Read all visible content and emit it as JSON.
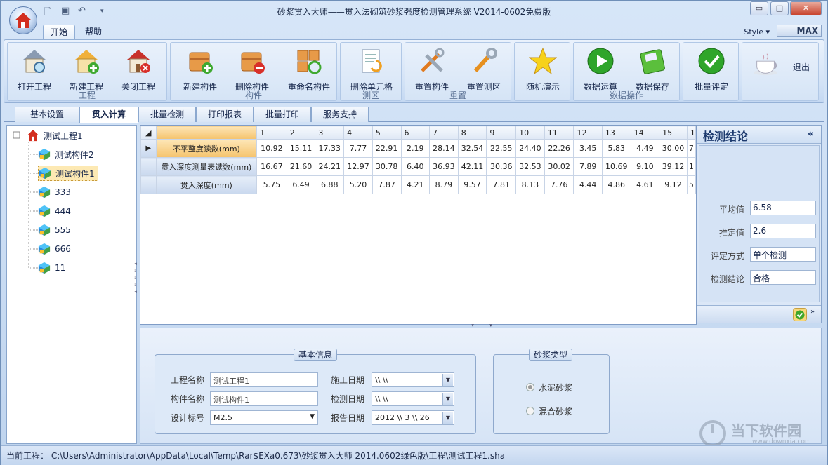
{
  "title": "砂浆贯入大师——贯入法砌筑砂浆强度检测管理系统  V2014-0602免费版",
  "ribbon_tabs": [
    "开始",
    "帮助"
  ],
  "style_label": "Style ▾",
  "max_label": "MAX",
  "groups": [
    {
      "label": "工程",
      "buttons": [
        "打开工程",
        "新建工程",
        "关闭工程"
      ]
    },
    {
      "label": "构件",
      "buttons": [
        "新建构件",
        "删除构件",
        "重命名构件"
      ]
    },
    {
      "label": "测区",
      "buttons": [
        "删除单元格"
      ]
    },
    {
      "label": "重置",
      "buttons": [
        "重置构件",
        "重置测区"
      ]
    },
    {
      "label": "",
      "buttons": [
        "随机演示"
      ]
    },
    {
      "label": "数据操作",
      "buttons": [
        "数据运算",
        "数据保存"
      ]
    },
    {
      "label": "",
      "buttons": [
        "批量评定"
      ]
    },
    {
      "label": "",
      "buttons": [
        "退出"
      ]
    }
  ],
  "tabs": [
    "基本设置",
    "贯入计算",
    "批量检测",
    "打印报表",
    "批量打印",
    "服务支持"
  ],
  "tree": {
    "root": "测试工程1",
    "children": [
      "测试构件2",
      "测试构件1",
      "333",
      "444",
      "555",
      "666",
      "11"
    ]
  },
  "grid": {
    "columns": [
      "1",
      "2",
      "3",
      "4",
      "5",
      "6",
      "7",
      "8",
      "9",
      "10",
      "11",
      "12",
      "13",
      "14",
      "15",
      "1"
    ],
    "rows": [
      {
        "label": "不平整度读数(mm)",
        "values": [
          "10.92",
          "15.11",
          "17.33",
          "7.77",
          "22.91",
          "2.19",
          "28.14",
          "32.54",
          "22.55",
          "24.40",
          "22.26",
          "3.45",
          "5.83",
          "4.49",
          "30.00",
          "7"
        ]
      },
      {
        "label": "贯入深度测量表读数(mm)",
        "values": [
          "16.67",
          "21.60",
          "24.21",
          "12.97",
          "30.78",
          "6.40",
          "36.93",
          "42.11",
          "30.36",
          "32.53",
          "30.02",
          "7.89",
          "10.69",
          "9.10",
          "39.12",
          "1"
        ]
      },
      {
        "label": "贯入深度(mm)",
        "values": [
          "5.75",
          "6.49",
          "6.88",
          "5.20",
          "7.87",
          "4.21",
          "8.79",
          "9.57",
          "7.81",
          "8.13",
          "7.76",
          "4.44",
          "4.86",
          "4.61",
          "9.12",
          "5"
        ]
      }
    ]
  },
  "result": {
    "title": "检测结论",
    "collapse": "«",
    "fields": [
      {
        "label": "平均值",
        "value": "6.58"
      },
      {
        "label": "推定值",
        "value": "2.6"
      },
      {
        "label": "评定方式",
        "value": "单个检测"
      },
      {
        "label": "检测结论",
        "value": "合格"
      }
    ]
  },
  "basic_info": {
    "legend": "基本信息",
    "project_name_label": "工程名称",
    "project_name": "测试工程1",
    "member_name_label": "构件名称",
    "member_name": "测试构件1",
    "design_grade_label": "设计标号",
    "design_grade": "M2.5",
    "build_date_label": "施工日期",
    "build_date": "\\\\   \\\\",
    "test_date_label": "检测日期",
    "test_date": "\\\\   \\\\",
    "report_date_label": "报告日期",
    "report_date": "2012 \\\\ 3 \\\\ 26"
  },
  "mortar": {
    "legend": "砂浆类型",
    "options": [
      "水泥砂浆",
      "混合砂浆"
    ],
    "selected": "水泥砂浆"
  },
  "status": "当前工程：   C:\\Users\\Administrator\\AppData\\Local\\Temp\\Rar$EXa0.673\\砂浆贯入大师  2014.0602绿色版\\工程\\测试工程1.sha",
  "watermark": {
    "name": "当下软件园",
    "url": "www.downxia.com"
  },
  "colors": {
    "accent": "#1d3a6e",
    "ribbon": "#d2e2f6",
    "selected_row": "#f5c36d",
    "ok_green": "#3ea52a"
  }
}
